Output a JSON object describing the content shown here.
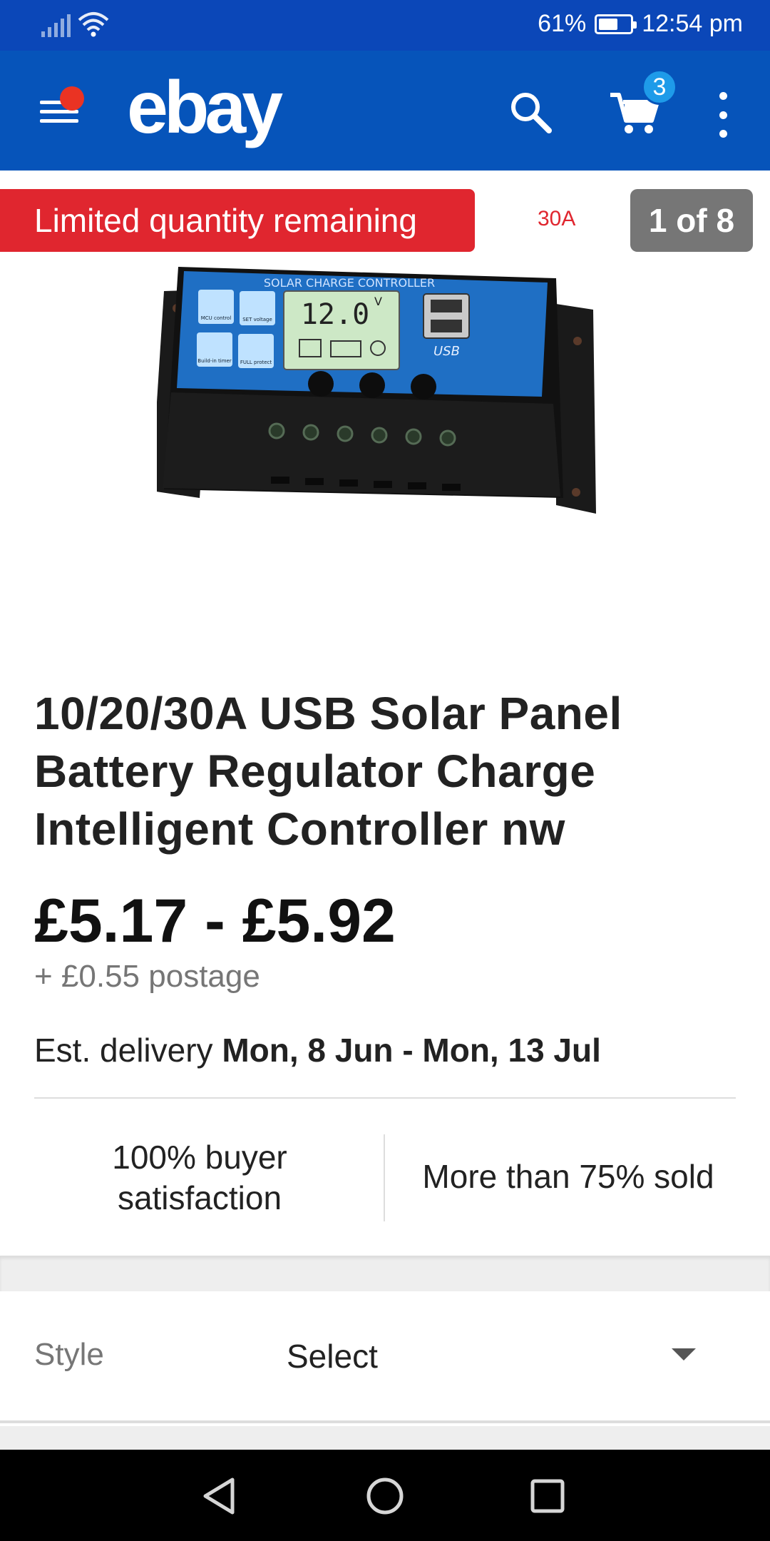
{
  "status_bar": {
    "battery_percent": "61%",
    "battery_level": 0.61,
    "time": "12:54 pm",
    "icons": [
      "signal-icon",
      "wifi-icon",
      "battery-icon"
    ]
  },
  "app_bar": {
    "logo": "ebay",
    "cart_count": "3",
    "icons": [
      "menu-icon",
      "search-icon",
      "cart-icon",
      "more-vert-icon"
    ],
    "colors": {
      "background": "#0654ba",
      "status": "#0b47b8",
      "notification": "#ea3323",
      "badge": "#1e9be9"
    }
  },
  "gallery": {
    "limited_badge": "Limited quantity remaining",
    "variant_label": "30A",
    "counter": "1 of 8",
    "image": {
      "header": "SOLAR CHARGE CONTROLLER",
      "display": "12.0",
      "display_unit": "V",
      "usb_label": "USB",
      "badges": [
        "MCU control",
        "SET voltage",
        "Build-in timer",
        "FULL protect"
      ]
    }
  },
  "listing": {
    "title": "10/20/30A USB Solar Panel Battery Regulator Charge Intelligent Controller nw",
    "price": "£5.17 - £5.92",
    "postage": "+ £0.55 postage",
    "delivery_prefix": "Est. delivery",
    "delivery_dates": "Mon, 8 Jun - Mon, 13 Jul",
    "stat_satisfaction": "100% buyer satisfaction",
    "stat_sold": "More than 75% sold"
  },
  "variation": {
    "label": "Style",
    "value": "Select"
  },
  "nav_bar": {
    "icons": [
      "back-icon",
      "home-icon",
      "recents-icon"
    ]
  }
}
